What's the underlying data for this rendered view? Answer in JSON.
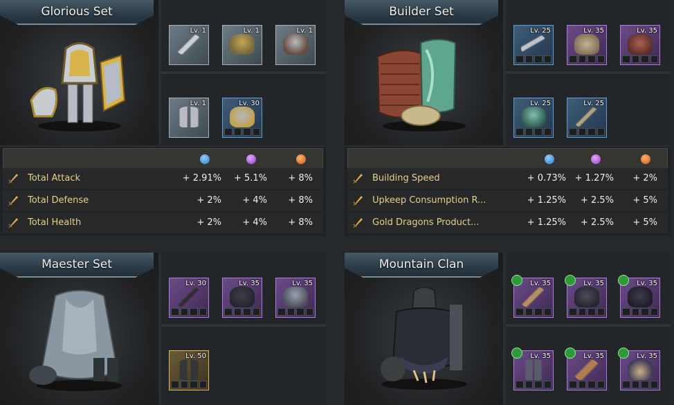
{
  "sets": [
    {
      "title": "Glorious Set",
      "slots": [
        {
          "level": "Lv. 1",
          "rarity": "grey",
          "icon": "sword-icon"
        },
        {
          "level": "Lv. 1",
          "rarity": "grey",
          "icon": "helmet-icon"
        },
        {
          "level": "Lv. 1",
          "rarity": "grey",
          "icon": "chest-armor-icon"
        },
        {
          "level": "Lv. 1",
          "rarity": "grey",
          "icon": "greaves-icon"
        },
        {
          "level": "Lv. 30",
          "rarity": "blue",
          "icon": "shield-icon"
        }
      ],
      "bonuses": [
        {
          "name": "Total Attack",
          "values": [
            "+ 2.91%",
            "+ 5.1%",
            "+ 8%"
          ]
        },
        {
          "name": "Total Defense",
          "values": [
            "+ 2%",
            "+ 4%",
            "+ 8%"
          ]
        },
        {
          "name": "Total Health",
          "values": [
            "+ 2%",
            "+ 4%",
            "+ 8%"
          ]
        }
      ]
    },
    {
      "title": "Builder Set",
      "slots": [
        {
          "level": "Lv. 25",
          "rarity": "blue",
          "icon": "pickaxe-icon"
        },
        {
          "level": "Lv. 35",
          "rarity": "purple",
          "icon": "cloth-hat-icon"
        },
        {
          "level": "Lv. 35",
          "rarity": "purple",
          "icon": "leather-vest-icon"
        },
        {
          "level": "Lv. 25",
          "rarity": "blue",
          "icon": "cloak-icon"
        },
        {
          "level": "Lv. 25",
          "rarity": "blue",
          "icon": "hammer-icon"
        }
      ],
      "bonuses": [
        {
          "name": "Building Speed",
          "values": [
            "+ 0.73%",
            "+ 1.27%",
            "+ 2%"
          ]
        },
        {
          "name": "Upkeep Consumption R...",
          "values": [
            "+ 1.25%",
            "+ 2.5%",
            "+ 5%"
          ]
        },
        {
          "name": "Gold Dragons Product...",
          "values": [
            "+ 1.25%",
            "+ 2.5%",
            "+ 5%"
          ]
        }
      ]
    },
    {
      "title": "Maester Set",
      "slots": [
        {
          "level": "Lv. 30",
          "rarity": "purple",
          "icon": "quill-icon"
        },
        {
          "level": "Lv. 35",
          "rarity": "purple",
          "icon": "hood-icon"
        },
        {
          "level": "Lv. 35",
          "rarity": "purple",
          "icon": "robe-icon"
        },
        {
          "level": "Lv. 50",
          "rarity": "gold",
          "icon": "boots-icon"
        }
      ]
    },
    {
      "title": "Mountain Clan",
      "slots": [
        {
          "level": "Lv. 35",
          "rarity": "purple",
          "icon": "club-icon"
        },
        {
          "level": "Lv. 35",
          "rarity": "purple",
          "icon": "helm-icon"
        },
        {
          "level": "Lv. 35",
          "rarity": "purple",
          "icon": "fur-armor-icon"
        },
        {
          "level": "Lv. 35",
          "rarity": "purple",
          "icon": "leggings-icon"
        },
        {
          "level": "Lv. 35",
          "rarity": "purple",
          "icon": "belt-icon"
        },
        {
          "level": "Lv. 35",
          "rarity": "purple",
          "icon": "claw-necklace-icon"
        }
      ]
    }
  ],
  "colors": {
    "grey": "#a8b4bb",
    "blue": "#5f9fd6",
    "purple": "#b07ae0",
    "gold": "#e3b850",
    "bonus_text": "#e9cf8c"
  }
}
